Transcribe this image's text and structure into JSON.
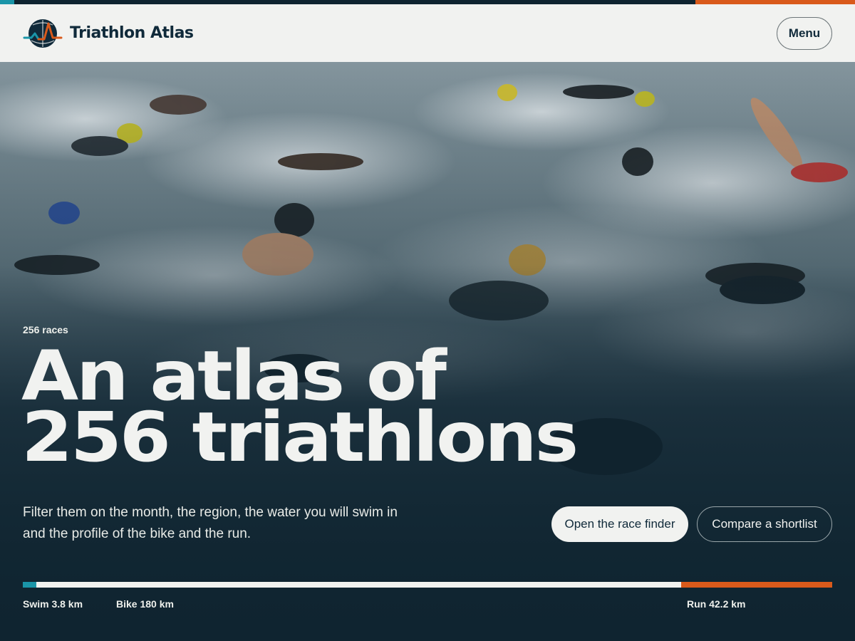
{
  "brand": {
    "name": "Triathlon Atlas",
    "logo_icon": "globe-pulse-icon"
  },
  "header": {
    "menu_label": "Menu"
  },
  "hero": {
    "count_label": "256 races",
    "title_line1": "An atlas of",
    "title_line2": "256 triathlons",
    "description_line1": "Filter them on the month, the region, the water you will swim in",
    "description_line2": "and the profile of the bike and the run.",
    "primary_cta": "Open the race finder",
    "secondary_cta": "Compare a shortlist",
    "photo": "open-water-swim-start-photo"
  },
  "distances": [
    {
      "label": "Swim 3.8 km",
      "km": 3.8,
      "color": "#1a95a8"
    },
    {
      "label": "Bike 180 km",
      "km": 180,
      "color": "#f1f2f0"
    },
    {
      "label": "Run 42.2 km",
      "km": 42.2,
      "color": "#d95a1b"
    }
  ],
  "colors": {
    "navy": "#0f2430",
    "teal": "#1a95a8",
    "orange": "#d95a1b",
    "paper": "#f1f2f0"
  }
}
